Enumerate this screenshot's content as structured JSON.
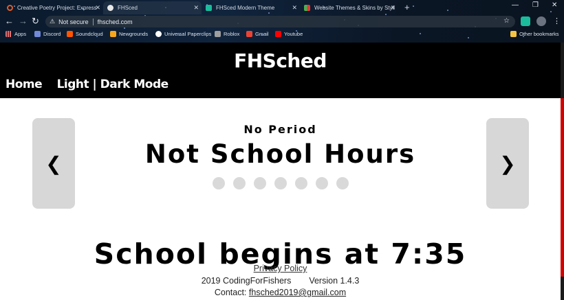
{
  "browser": {
    "tabs": [
      {
        "title": "Creative Poetry Project: Express",
        "color": "#e05c2a"
      },
      {
        "title": "FHSced",
        "color": "#e8e8e8"
      },
      {
        "title": "FHSced Modern Theme",
        "color": "#1abc9c"
      },
      {
        "title": "Website Themes & Skins by Styli",
        "color": "#4caf50"
      }
    ],
    "address": {
      "security_label": "Not secure",
      "url": "fhsched.com"
    },
    "bookmarks": [
      {
        "label": "Apps",
        "color": "#e57373"
      },
      {
        "label": "Discord",
        "color": "#7289da"
      },
      {
        "label": "Soundcloud",
        "color": "#ff5500"
      },
      {
        "label": "Newgrounds",
        "color": "#f7a71c"
      },
      {
        "label": "Universal Paperclips",
        "color": "#ffffff"
      },
      {
        "label": "Roblox",
        "color": "#9e9e9e"
      },
      {
        "label": "Gmail",
        "color": "#ea4335"
      },
      {
        "label": "Youtube",
        "color": "#ff0000"
      }
    ],
    "other_bookmarks": "Other bookmarks"
  },
  "site": {
    "title": "FHSched",
    "nav": {
      "home": "Home",
      "mode": "Light | Dark Mode"
    },
    "carousel": {
      "prev": "❮",
      "next": "❯",
      "period": "No Period",
      "status": "Not School Hours",
      "dot_count": 7
    },
    "begins": "School begins at 7:35",
    "footer": {
      "privacy": "Privacy Policy",
      "copyright": "2019 CodingForFishers",
      "version": "Version 1.4.3",
      "contact_label": "Contact:",
      "email": "fhsched2019@gmail.com"
    },
    "colors": {
      "header_bg": "#000000",
      "accent": "#d40000",
      "arrow_bg": "#d7d7d7",
      "dot": "#d9d9d9"
    }
  }
}
